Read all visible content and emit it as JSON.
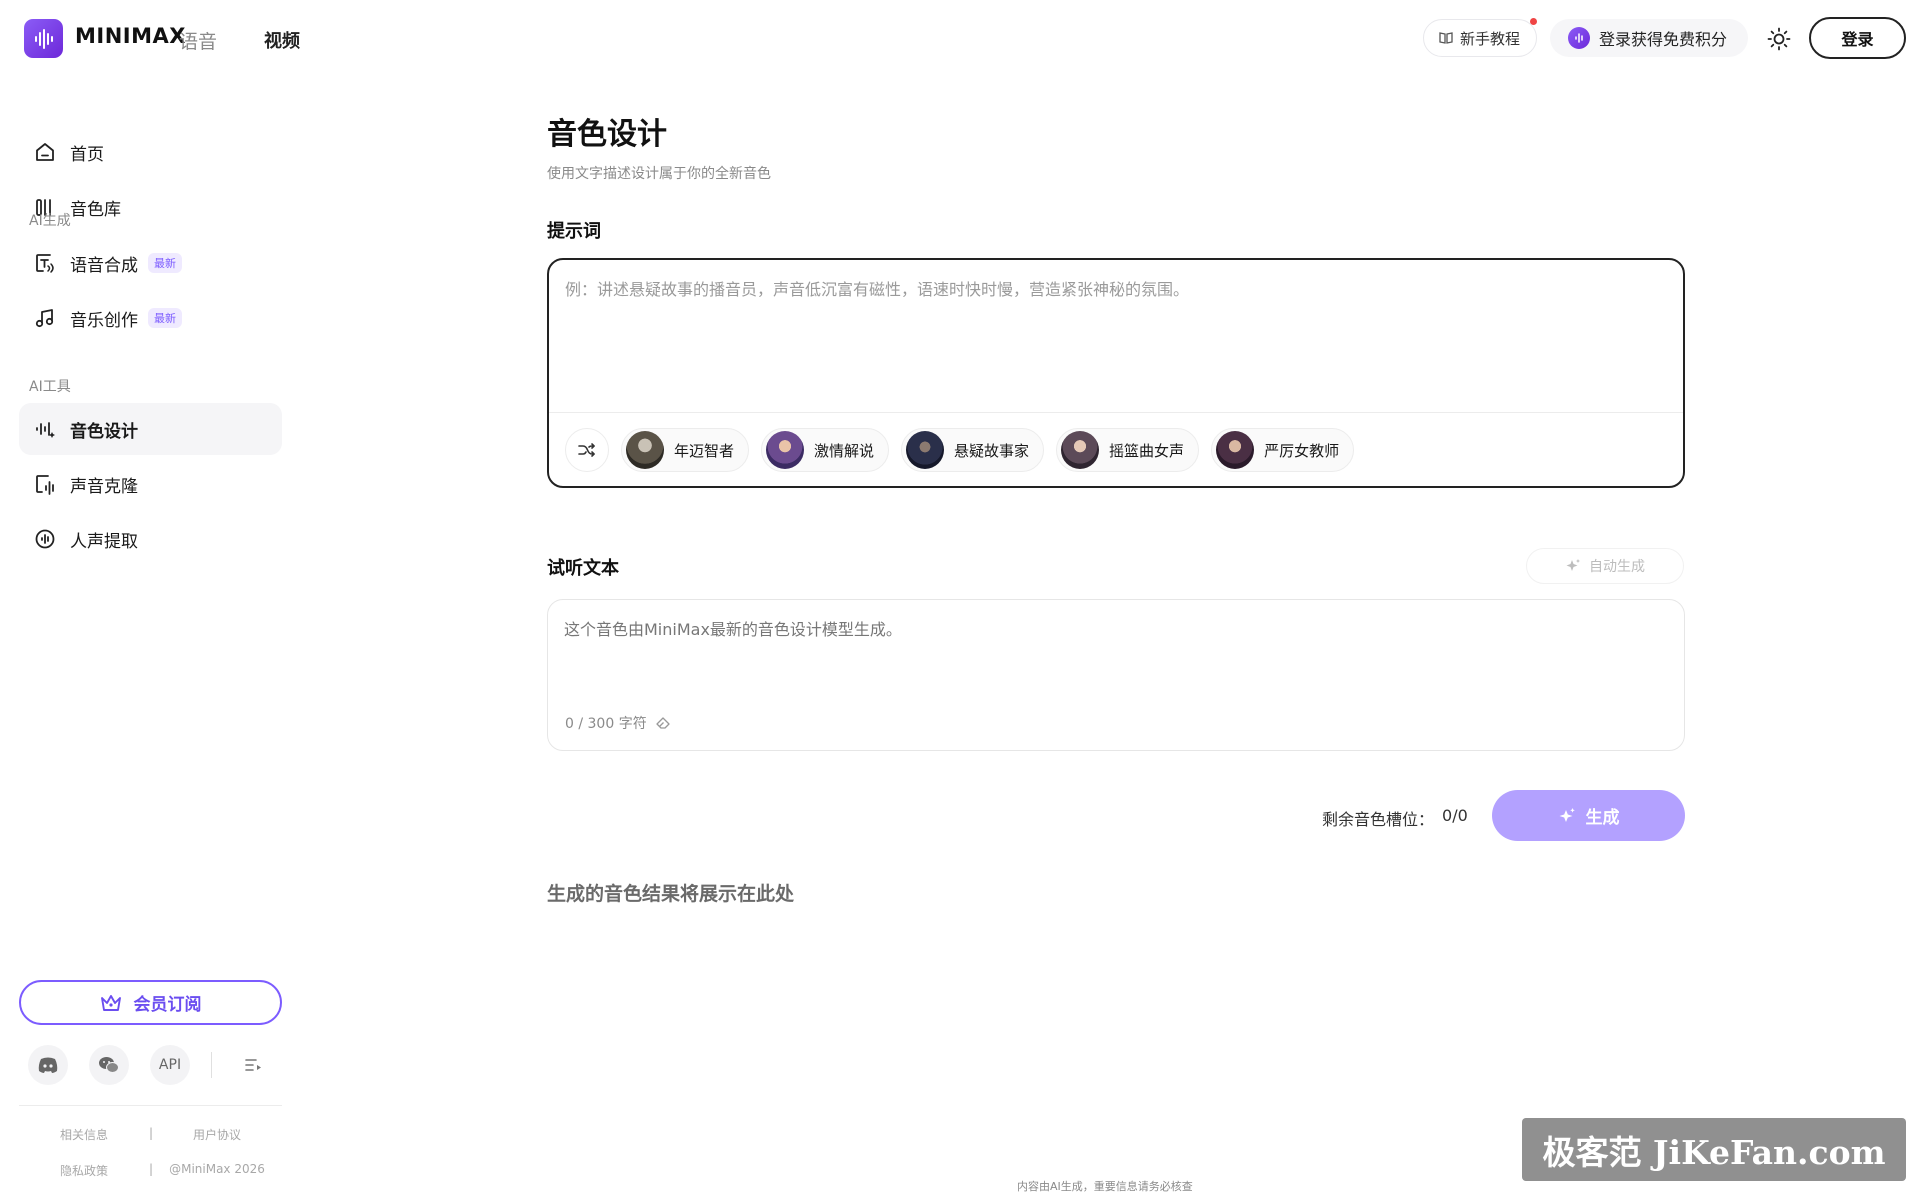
{
  "header": {
    "brand": "MINIMAX",
    "brand_sub": "语音",
    "nav_video": "视频",
    "tutorial": "新手教程",
    "credits": "登录获得免费积分",
    "login": "登录"
  },
  "sidebar": {
    "home": "首页",
    "voice_library": "音色库",
    "section_ai_gen": "AI生成",
    "tts": "语音合成",
    "music": "音乐创作",
    "badge_new": "最新",
    "section_ai_tools": "AI工具",
    "voice_design": "音色设计",
    "voice_clone": "声音克隆",
    "vocal_extract": "人声提取",
    "membership": "会员订阅",
    "api": "API",
    "links": {
      "related": "相关信息",
      "terms": "用户协议",
      "privacy": "隐私政策",
      "copyright": "@MiniMax 2026",
      "sep": "|"
    }
  },
  "main": {
    "title": "音色设计",
    "subtitle": "使用文字描述设计属于你的全新音色",
    "prompt_label": "提示词",
    "prompt_placeholder": "例：讲述悬疑故事的播音员，声音低沉富有磁性，语速时快时慢，营造紧张神秘的氛围。",
    "presets": [
      "年迈智者",
      "激情解说",
      "悬疑故事家",
      "摇篮曲女声",
      "严厉女教师"
    ],
    "preview_label": "试听文本",
    "auto_generate": "自动生成",
    "preview_placeholder": "这个音色由MiniMax最新的音色设计模型生成。",
    "char_count": "0 / 300 字符",
    "slots_label": "剩余音色槽位：",
    "slots_value": "0/0",
    "generate": "生成",
    "result_hint": "生成的音色结果将展示在此处",
    "disclaimer": "内容由AI生成，重要信息请务必核查"
  },
  "watermark": "极客范 JiKeFan.com",
  "colors": {
    "accent": "#7c5cff",
    "generate_bg": "#b3a1ff",
    "active_bg": "#f5f5f7"
  }
}
